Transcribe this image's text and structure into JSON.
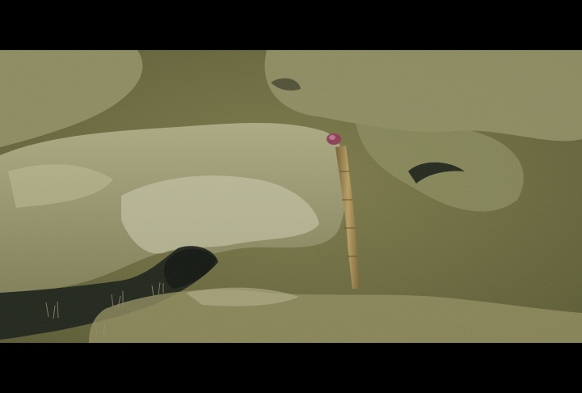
{
  "image": {
    "subject": "seafloor-rock-with-tube-worm",
    "colors": {
      "letterbox": "#000000",
      "sediment": "#6b6a3c",
      "rock_light": "#a3a27a",
      "rock_pale": "#c9c9b0",
      "shadow": "#1e2216",
      "tube": "#a08a55",
      "tube_tip": "#8a3a55"
    }
  }
}
